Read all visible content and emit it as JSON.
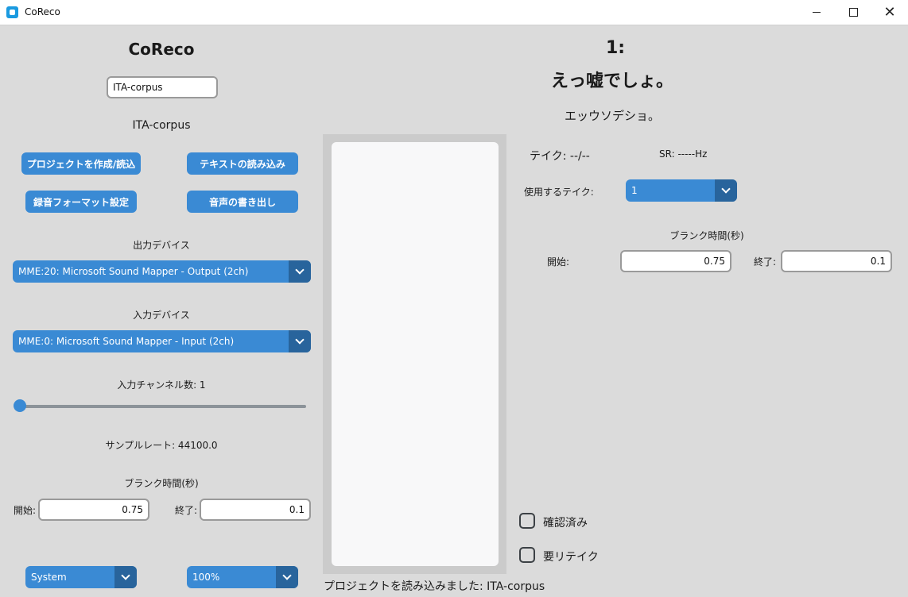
{
  "window": {
    "title": "CoReco"
  },
  "left": {
    "app_title": "CoReco",
    "project_input_value": "ITA-corpus",
    "project_name": "ITA-corpus",
    "buttons": {
      "create_load": "プロジェクトを作成/読込",
      "load_text": "テキストの読み込み",
      "record_format": "録音フォーマット設定",
      "export_audio": "音声の書き出し"
    },
    "output_device": {
      "label": "出力デバイス",
      "selected": "MME:20: Microsoft Sound Mapper - Output (2ch)"
    },
    "input_device": {
      "label": "入力デバイス",
      "selected": "MME:0: Microsoft Sound Mapper - Input (2ch)"
    },
    "channels": {
      "label": "入力チャンネル数: 1",
      "value": 1
    },
    "sample_rate": "サンプルレート: 44100.0",
    "blank_time": {
      "label": "ブランク時間(秒)",
      "start_label": "開始:",
      "start_value": "0.75",
      "end_label": "終了:",
      "end_value": "0.1"
    },
    "theme": "System",
    "scale": "100%"
  },
  "right": {
    "sentence_number": "1:",
    "sentence_text": "えっ嘘でしょ。",
    "reading": "エッウソデショ。",
    "take": "テイク: --/--",
    "sr": "SR: -----Hz",
    "use_take_label": "使用するテイク:",
    "use_take_value": "1",
    "blank_time": {
      "label": "ブランク時間(秒)",
      "start_label": "開始:",
      "start_value": "0.75",
      "end_label": "終了:",
      "end_value": "0.1"
    },
    "checked_label": "確認済み",
    "retake_label": "要リテイク"
  },
  "status": "プロジェクトを読み込みました: ITA-corpus",
  "colors": {
    "accent": "#3a8ad4",
    "accent_dark": "#28649c",
    "background": "#dbdbdb"
  }
}
